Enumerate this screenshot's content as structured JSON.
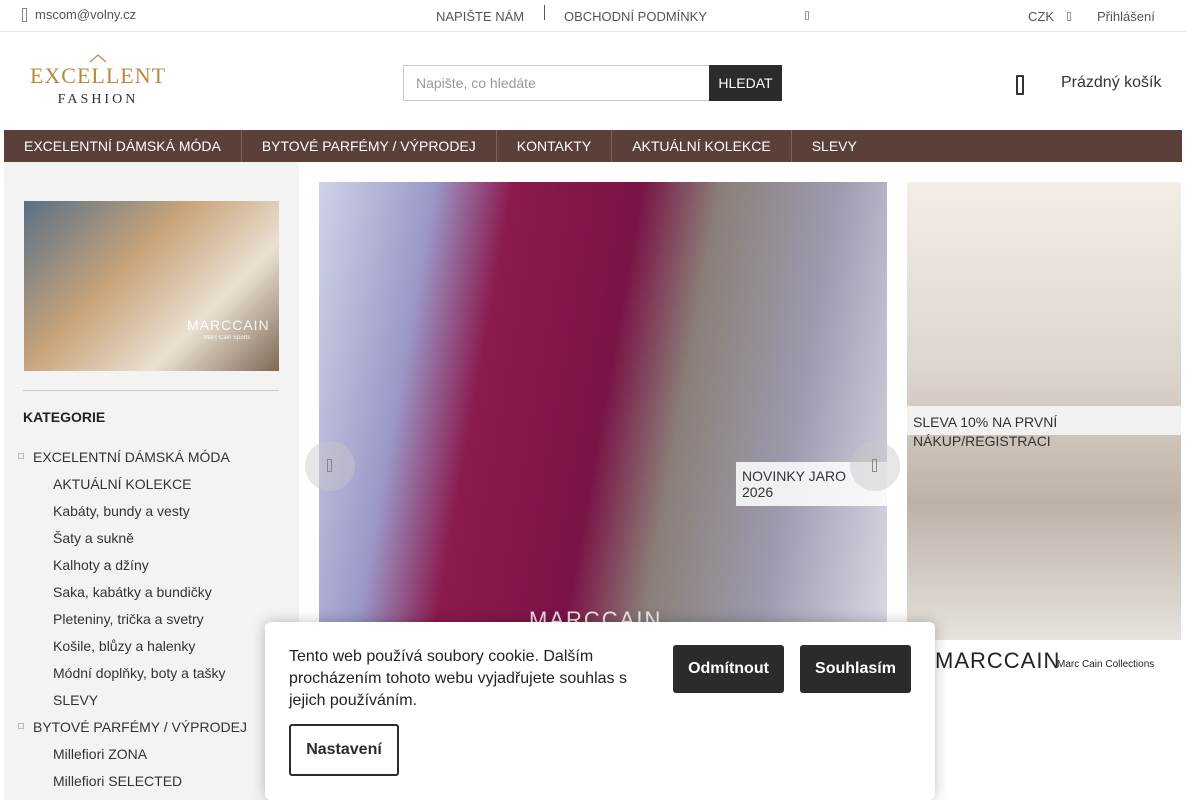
{
  "topbar": {
    "email": "mscom@volny.cz",
    "links": [
      "NAPIŠTE NÁM",
      "OBCHODNÍ PODMÍNKY"
    ],
    "currency": "CZK",
    "login": "Přihlášení"
  },
  "header": {
    "logo": {
      "line1": "EXCELLENT",
      "line2": "FASHION"
    },
    "search": {
      "placeholder": "Napište, co hledáte",
      "button": "HLEDAT"
    },
    "cart_label": "Prázdný košík"
  },
  "nav": [
    "EXCELENTNÍ DÁMSKÁ MÓDA",
    "BYTOVÉ PARFÉMY / VÝPRODEJ",
    "KONTAKTY",
    "AKTUÁLNÍ KOLEKCE",
    "SLEVY"
  ],
  "sidebar": {
    "banner_brand": "MARCCAIN",
    "banner_tag": "Marc Cain Sports",
    "category_title": "KATEGORIE",
    "categories": [
      {
        "label": "EXCELENTNÍ DÁMSKÁ MÓDA",
        "children": [
          "AKTUÁLNÍ KOLEKCE",
          "Kabáty, bundy a vesty",
          "Šaty a sukně",
          "Kalhoty a džíny",
          "Saka, kabátky a bundičky",
          "Pleteniny, trička a svetry",
          "Košile, blůzy a halenky",
          "Módní doplňky, boty a tašky",
          "SLEVY"
        ]
      },
      {
        "label": "BYTOVÉ PARFÉMY / VÝPRODEJ",
        "children": [
          "Millefiori ZONA",
          "Millefiori SELECTED"
        ]
      }
    ]
  },
  "main": {
    "slide_brand": "MARCCAIN",
    "slide_caption": "NOVINKY JARO 2026",
    "side_banner_text": "SLEVA 10% NA PRVNÍ NÁKUP/REGISTRACI",
    "logo1": "MARCCAIN",
    "logo2": "Marc Cain Collections"
  },
  "cookie": {
    "text": "Tento web používá soubory cookie. Dalším procházením tohoto webu vyjadřujete souhlas s jejich používáním.",
    "reject": "Odmítnout",
    "accept": "Souhlasím",
    "settings": "Nastavení"
  },
  "colors": {
    "nav_bg": "#5a4038",
    "button_dark": "#2b2b2b",
    "logo_gold": "#b8893f"
  },
  "icons": [
    "mail-icon",
    "social-icon",
    "chevron-down-icon",
    "cart-icon",
    "arrow-left-icon",
    "arrow-right-icon"
  ]
}
